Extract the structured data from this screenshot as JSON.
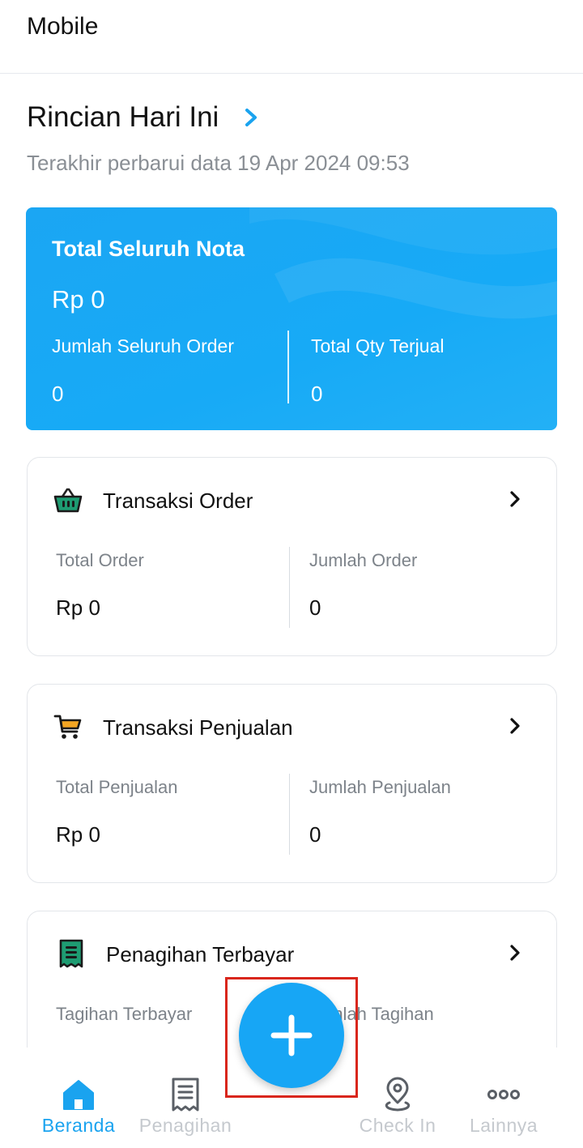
{
  "app_bar": {
    "title": "Mobile"
  },
  "section": {
    "title": "Rincian Hari Ini",
    "updated": "Terakhir perbarui data 19 Apr 2024 09:53"
  },
  "summary": {
    "label": "Total Seluruh Nota",
    "amount": "Rp 0",
    "left_label": "Jumlah Seluruh Order",
    "left_value": "0",
    "right_label": "Total Qty Terjual",
    "right_value": "0"
  },
  "cards": [
    {
      "title": "Transaksi Order",
      "icon": "basket-icon",
      "left_label": "Total Order",
      "left_value": "Rp 0",
      "right_label": "Jumlah Order",
      "right_value": "0"
    },
    {
      "title": "Transaksi Penjualan",
      "icon": "cart-icon",
      "left_label": "Total Penjualan",
      "left_value": "Rp 0",
      "right_label": "Jumlah Penjualan",
      "right_value": "0"
    },
    {
      "title": "Penagihan Terbayar",
      "icon": "receipt-icon",
      "left_label": "Tagihan Terbayar",
      "right_label": "Jumlah Tagihan"
    }
  ],
  "nav": {
    "items": [
      {
        "label": "Beranda",
        "icon": "home-icon"
      },
      {
        "label": "Penagihan",
        "icon": "receipt-icon"
      },
      {
        "label": "Check In",
        "icon": "location-pin-icon"
      },
      {
        "label": "Lainnya",
        "icon": "more-dots-icon"
      }
    ],
    "active": "Beranda"
  },
  "fab": {
    "icon": "plus-icon"
  },
  "colors": {
    "accent": "#17A6F5",
    "inactive": "#C5C9CE",
    "highlight": "#D9261C"
  }
}
